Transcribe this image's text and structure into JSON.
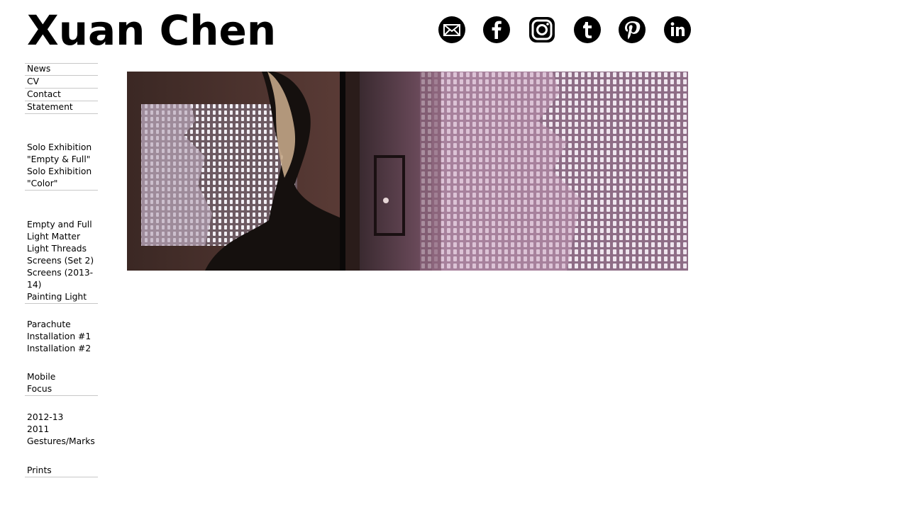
{
  "site": {
    "title": "Xuan Chen"
  },
  "social": [
    {
      "name": "email-icon",
      "label": "Email"
    },
    {
      "name": "facebook-icon",
      "label": "Facebook"
    },
    {
      "name": "instagram-icon",
      "label": "Instagram"
    },
    {
      "name": "tumblr-icon",
      "label": "Tumblr"
    },
    {
      "name": "pinterest-icon",
      "label": "Pinterest"
    },
    {
      "name": "linkedin-icon",
      "label": "LinkedIn"
    }
  ],
  "nav": {
    "top": {
      "news": "News",
      "cv": "CV",
      "contact": "Contact",
      "statement": "Statement"
    },
    "exhibitions": {
      "solo1": "Solo Exhibition",
      "empty_full": "\"Empty & Full\"",
      "solo2": "Solo Exhibition",
      "color": "\"Color\""
    },
    "works": {
      "empty_and_full": "Empty and Full",
      "light_matter": "Light Matter",
      "light_threads": "Light Threads",
      "screens_set2": "Screens (Set 2)",
      "screens_2013_a": "Screens (2013-",
      "screens_2013_b": "14)",
      "painting_light": "Painting Light"
    },
    "installations": {
      "parachute": "Parachute",
      "installation1": "Installation #1",
      "installation2": "Installation #2"
    },
    "mobile": {
      "mobile": "Mobile",
      "focus": "Focus"
    },
    "archive": {
      "y2012": "2012-13",
      "y2011": "2011",
      "gestures": "Gestures/Marks"
    },
    "prints": {
      "prints": "Prints"
    }
  },
  "colors": {
    "text": "#000000",
    "rule": "#c8c8c8",
    "background": "#ffffff"
  }
}
